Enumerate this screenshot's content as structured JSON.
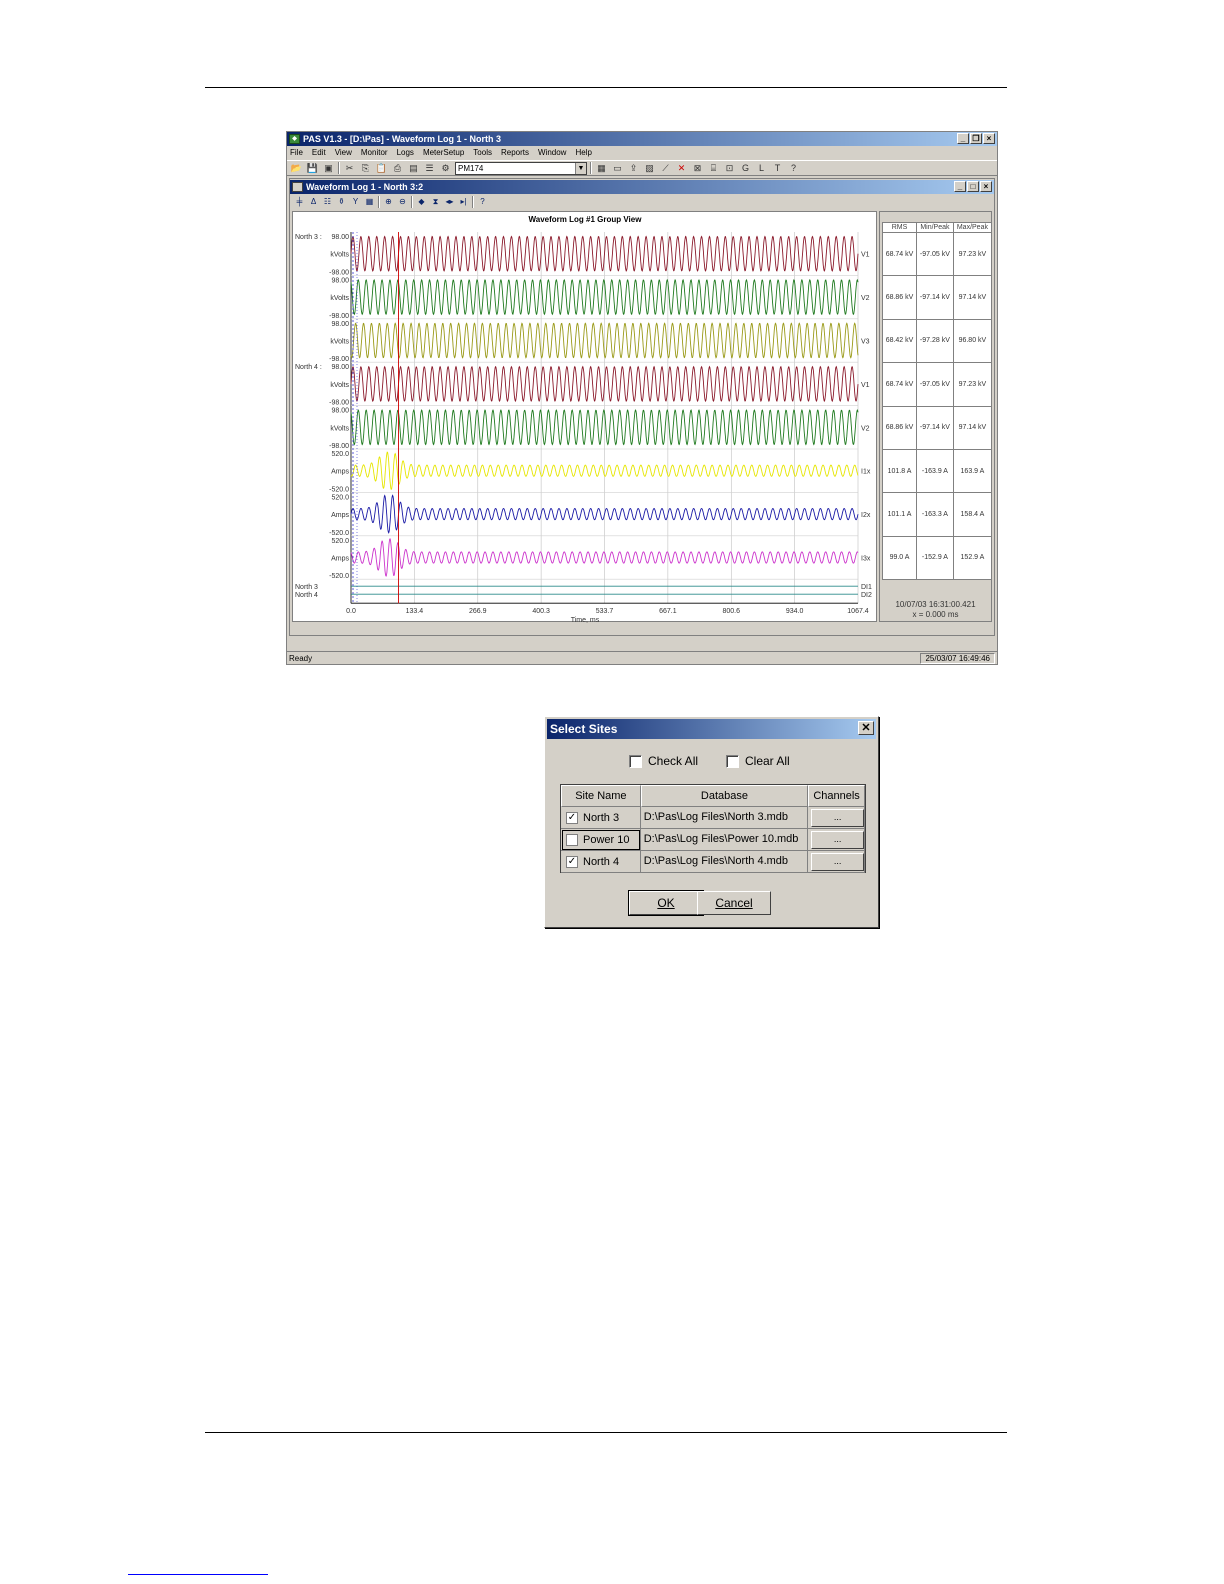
{
  "pas": {
    "title": "PAS V1.3 - [D:\\Pas] - Waveform Log 1 - North 3",
    "menu": [
      "File",
      "Edit",
      "View",
      "Monitor",
      "Logs",
      "MeterSetup",
      "Tools",
      "Reports",
      "Window",
      "Help"
    ],
    "device": "PM174",
    "child_title": "Waveform Log 1 - North 3:2",
    "status_left": "Ready",
    "status_time": "25/03/07 16:49:46"
  },
  "chart_data": {
    "type": "line",
    "title": "Waveform Log #1 Group View",
    "xlabel": "Time, ms",
    "x_ticks": [
      "0.0",
      "133.4",
      "266.9",
      "400.3",
      "533.7",
      "667.1",
      "800.6",
      "934.0",
      "1067.4"
    ],
    "xlim": [
      0,
      1067.4
    ],
    "site_labels": [
      "North 3 :",
      "North 4 :"
    ],
    "series": [
      {
        "name": "V1",
        "site": "North 3",
        "unit": "kVolts",
        "ymax": "98.00",
        "ymin": "-98.00",
        "color": "#8b1a2b",
        "cycles": 64,
        "amplitude": 0.92,
        "transient": false
      },
      {
        "name": "V2",
        "site": "North 3",
        "unit": "kVolts",
        "ymax": "98.00",
        "ymin": "-98.00",
        "color": "#1f7a1f",
        "cycles": 64,
        "amplitude": 0.92,
        "transient": false
      },
      {
        "name": "V3",
        "site": "North 3",
        "unit": "kVolts",
        "ymax": "98.00",
        "ymin": "-98.00",
        "color": "#9a9a18",
        "cycles": 64,
        "amplitude": 0.92,
        "transient": false
      },
      {
        "name": "V1",
        "site": "North 4",
        "unit": "kVolts",
        "ymax": "98.00",
        "ymin": "-98.00",
        "color": "#8b1a2b",
        "cycles": 64,
        "amplitude": 0.92,
        "transient": false
      },
      {
        "name": "V2",
        "site": "North 4",
        "unit": "kVolts",
        "ymax": "98.00",
        "ymin": "-98.00",
        "color": "#1f7a1f",
        "cycles": 64,
        "amplitude": 0.92,
        "transient": false
      },
      {
        "name": "I1x",
        "site": "North 4",
        "unit": "Amps",
        "ymax": "520.0",
        "ymin": "-520.0",
        "color": "#e6e600",
        "cycles": 64,
        "amplitude": 0.3,
        "transient": true
      },
      {
        "name": "I2x",
        "site": "North 4",
        "unit": "Amps",
        "ymax": "520.0",
        "ymin": "-520.0",
        "color": "#1a1aa6",
        "cycles": 64,
        "amplitude": 0.3,
        "transient": true
      },
      {
        "name": "I3x",
        "site": "North 4",
        "unit": "Amps",
        "ymax": "520.0",
        "ymin": "-520.0",
        "color": "#cc33cc",
        "cycles": 64,
        "amplitude": 0.3,
        "transient": true
      }
    ],
    "digital": [
      {
        "site": "North 3",
        "name": "DI1"
      },
      {
        "site": "North 4",
        "name": "DI2"
      }
    ],
    "cursor_ms": 0.0,
    "marker_ms": 100
  },
  "measurements": {
    "headers": [
      "RMS",
      "Min/Peak",
      "Max/Peak"
    ],
    "rows": [
      [
        "68.74 kV",
        "-97.05 kV",
        "97.23 kV"
      ],
      [
        "68.86 kV",
        "-97.14 kV",
        "97.14 kV"
      ],
      [
        "68.42 kV",
        "-97.28 kV",
        "96.80 kV"
      ],
      [
        "68.74 kV",
        "-97.05 kV",
        "97.23 kV"
      ],
      [
        "68.86 kV",
        "-97.14 kV",
        "97.14 kV"
      ],
      [
        "101.8 A",
        "-163.9 A",
        "163.9 A"
      ],
      [
        "101.1 A",
        "-163.3 A",
        "158.4 A"
      ],
      [
        "99.0 A",
        "-152.9 A",
        "152.9 A"
      ]
    ],
    "cursor_time": "10/07/03 16:31:00.421",
    "cursor_x": "x = 0.000 ms"
  },
  "dialog": {
    "title": "Select Sites",
    "check_all": "Check All",
    "clear_all": "Clear All",
    "columns": [
      "Site Name",
      "Database",
      "Channels"
    ],
    "rows": [
      {
        "name": "North 3",
        "db": "D:\\Pas\\Log Files\\North 3.mdb",
        "checked": true,
        "channels": "..."
      },
      {
        "name": "Power 10",
        "db": "D:\\Pas\\Log Files\\Power 10.mdb",
        "checked": false,
        "channels": "..."
      },
      {
        "name": "North 4",
        "db": "D:\\Pas\\Log Files\\North 4.mdb",
        "checked": true,
        "channels": "..."
      }
    ],
    "ok": "OK",
    "cancel": "Cancel"
  }
}
